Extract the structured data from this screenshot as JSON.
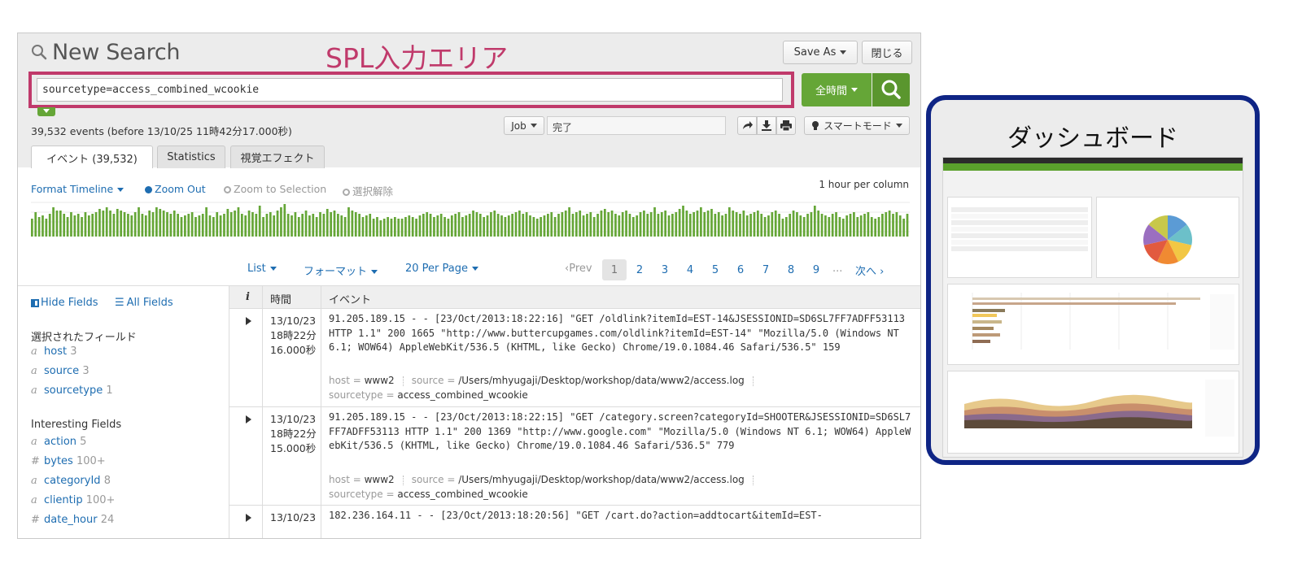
{
  "header": {
    "title": "New Search",
    "annotation": "SPL入力エリア",
    "save_as": "Save As",
    "close": "閉じる"
  },
  "search": {
    "query": "sourcetype=access_combined_wcookie",
    "time_range": "全時間"
  },
  "job": {
    "event_count": "39,532 events (before 13/10/25 11時42分17.000秒)",
    "job_label": "Job",
    "status": "完了",
    "mode": "スマートモード"
  },
  "tabs": [
    {
      "label": "イベント (39,532)"
    },
    {
      "label": "Statistics"
    },
    {
      "label": "視覚エフェクト"
    }
  ],
  "timeline": {
    "format": "Format Timeline",
    "zoom_out": "Zoom Out",
    "zoom_selection": "Zoom to Selection",
    "deselect": "選択解除",
    "scale": "1 hour per column",
    "bar_color": "#65a637",
    "bars": [
      0.55,
      0.75,
      0.6,
      0.65,
      0.55,
      0.7,
      0.9,
      0.8,
      0.8,
      0.7,
      0.6,
      0.75,
      0.65,
      0.7,
      0.6,
      0.75,
      0.65,
      0.7,
      0.75,
      0.85,
      0.8,
      0.9,
      0.8,
      0.7,
      0.85,
      0.8,
      0.75,
      0.7,
      0.65,
      0.75,
      0.9,
      0.7,
      0.65,
      0.8,
      0.75,
      0.9,
      0.85,
      0.8,
      0.75,
      0.7,
      0.8,
      0.7,
      0.6,
      0.65,
      0.7,
      0.75,
      0.6,
      0.65,
      0.7,
      0.9,
      0.65,
      0.6,
      0.75,
      0.65,
      0.7,
      0.85,
      0.75,
      0.8,
      0.9,
      0.7,
      0.65,
      0.8,
      0.75,
      0.7,
      0.95,
      0.6,
      0.7,
      0.75,
      0.65,
      0.8,
      0.9,
      1.0,
      0.7,
      0.65,
      0.75,
      0.6,
      0.7,
      0.8,
      0.65,
      0.7,
      0.6,
      0.75,
      0.7,
      0.85,
      0.75,
      0.8,
      0.7,
      0.65,
      0.6,
      0.9,
      0.8,
      0.75,
      0.7,
      0.6,
      0.65,
      0.7,
      0.55,
      0.6,
      0.5,
      0.55,
      0.6,
      0.55,
      0.6,
      0.55,
      0.55,
      0.6,
      0.65,
      0.6,
      0.55,
      0.65,
      0.7,
      0.75,
      0.7,
      0.6,
      0.65,
      0.7,
      0.6,
      0.55,
      0.65,
      0.7,
      0.75,
      0.6,
      0.65,
      0.7,
      0.8,
      0.75,
      0.7,
      0.6,
      0.65,
      0.75,
      0.8,
      0.7,
      0.65,
      0.6,
      0.65,
      0.7,
      0.75,
      0.8,
      0.7,
      0.75,
      0.65,
      0.6,
      0.55,
      0.6,
      0.65,
      0.7,
      0.75,
      0.6,
      0.7,
      0.75,
      0.8,
      0.9,
      0.7,
      0.75,
      0.8,
      0.65,
      0.7,
      0.75,
      0.6,
      0.7,
      0.8,
      0.85,
      0.75,
      0.8,
      0.7,
      0.65,
      0.75,
      0.8,
      0.7,
      0.6,
      0.65,
      0.75,
      0.8,
      0.7,
      0.75,
      0.9,
      0.7,
      0.75,
      0.8,
      0.65,
      0.7,
      0.75,
      0.85,
      0.95,
      0.8,
      0.7,
      0.75,
      0.8,
      0.9,
      0.75,
      0.8,
      0.85,
      0.7,
      0.75,
      0.65,
      0.7,
      0.9,
      0.8,
      0.75,
      0.7,
      0.8,
      0.65,
      0.7,
      0.75,
      0.8,
      0.7,
      0.6,
      0.65,
      0.75,
      0.8,
      0.7,
      0.55,
      0.6,
      0.7,
      0.8,
      0.75,
      0.65,
      0.6,
      0.7,
      0.75,
      0.95,
      0.8,
      0.7,
      0.65,
      0.6,
      0.7,
      0.75,
      0.6,
      0.55,
      0.65,
      0.7,
      0.75,
      0.6,
      0.65,
      0.7,
      0.75,
      0.6,
      0.55,
      0.6,
      0.7,
      0.75,
      0.8,
      0.7,
      0.75,
      0.65,
      0.55,
      0.7
    ]
  },
  "pagination": {
    "list": "List",
    "format": "フォーマット",
    "per_page": "20 Per Page",
    "prev": "Prev",
    "pages": [
      "1",
      "2",
      "3",
      "4",
      "5",
      "6",
      "7",
      "8",
      "9"
    ],
    "ellipsis": "...",
    "next": "次へ"
  },
  "fields": {
    "hide": "Hide Fields",
    "all": "All Fields",
    "selected_heading": "選択されたフィールド",
    "selected": [
      {
        "type": "a",
        "name": "host",
        "count": "3"
      },
      {
        "type": "a",
        "name": "source",
        "count": "3"
      },
      {
        "type": "a",
        "name": "sourcetype",
        "count": "1"
      }
    ],
    "interesting_heading": "Interesting Fields",
    "interesting": [
      {
        "type": "a",
        "name": "action",
        "count": "5"
      },
      {
        "type": "#",
        "name": "bytes",
        "count": "100+"
      },
      {
        "type": "a",
        "name": "categoryId",
        "count": "8"
      },
      {
        "type": "a",
        "name": "clientip",
        "count": "100+"
      },
      {
        "type": "#",
        "name": "date_hour",
        "count": "24"
      }
    ]
  },
  "events": {
    "col_info": "i",
    "col_time": "時間",
    "col_event": "イベント",
    "rows": [
      {
        "time": "13/10/23 18時22分16.000秒",
        "raw": "91.205.189.15 - - [23/Oct/2013:18:22:16] \"GET /oldlink?itemId=EST-14&JSESSIONID=SD6SL7FF7ADFF53113 HTTP 1.1\" 200 1665 \"http://www.buttercupgames.com/oldlink?itemId=EST-14\" \"Mozilla/5.0 (Windows NT 6.1; WOW64) AppleWebKit/536.5 (KHTML, like Gecko) Chrome/19.0.1084.46 Safari/536.5\" 159",
        "host_key": "host =",
        "host": "www2",
        "source_key": "source =",
        "source": "/Users/mhyugaji/Desktop/workshop/data/www2/access.log",
        "sourcetype_key": "sourcetype =",
        "sourcetype": "access_combined_wcookie"
      },
      {
        "time": "13/10/23 18時22分15.000秒",
        "raw": "91.205.189.15 - - [23/Oct/2013:18:22:15] \"GET /category.screen?categoryId=SHOOTER&JSESSIONID=SD6SL7FF7ADFF53113 HTTP 1.1\" 200 1369 \"http://www.google.com\" \"Mozilla/5.0 (Windows NT 6.1; WOW64) AppleWebKit/536.5 (KHTML, like Gecko) Chrome/19.0.1084.46 Safari/536.5\" 779",
        "host_key": "host =",
        "host": "www2",
        "source_key": "source =",
        "source": "/Users/mhyugaji/Desktop/workshop/data/www2/access.log",
        "sourcetype_key": "sourcetype =",
        "sourcetype": "access_combined_wcookie"
      },
      {
        "time": "13/10/23",
        "raw": "182.236.164.11 - - [23/Oct/2013:18:20:56] \"GET /cart.do?action=addtocart&itemId=EST-"
      }
    ]
  },
  "dashboard": {
    "title": "ダッシュボード",
    "pie_colors": [
      "#5b9bd5",
      "#6cc0c9",
      "#f2c744",
      "#f08a32",
      "#e25a3f",
      "#9b6fc0",
      "#c8c84a"
    ],
    "accent": "#0f2585"
  },
  "colors": {
    "splunk_green": "#65a637",
    "annotation": "#c03a6b",
    "link": "#1e6db1"
  }
}
